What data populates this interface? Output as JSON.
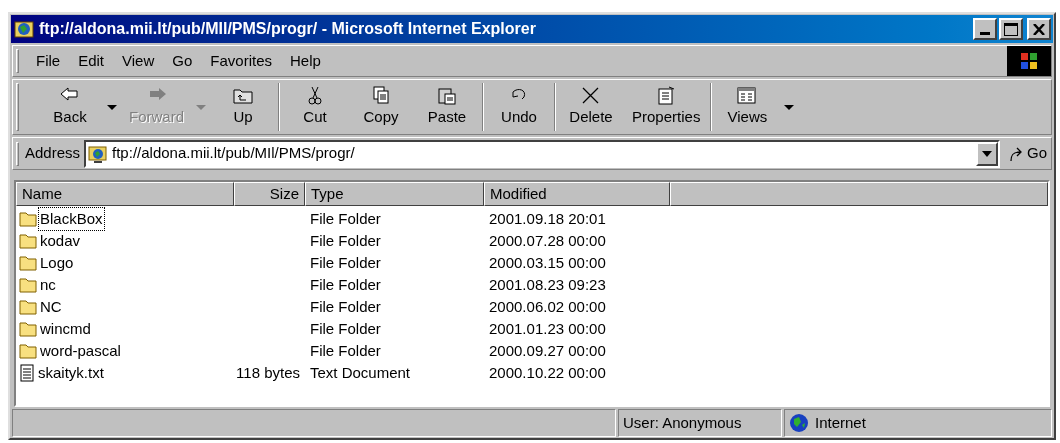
{
  "window": {
    "title": "ftp://aldona.mii.lt/pub/MIl/PMS/progr/ - Microsoft Internet Explorer"
  },
  "menu": [
    "File",
    "Edit",
    "View",
    "Go",
    "Favorites",
    "Help"
  ],
  "toolbar": [
    {
      "label": "Back",
      "disabled": false,
      "dropdown": true,
      "separator_before": false
    },
    {
      "label": "Forward",
      "disabled": true,
      "dropdown": true,
      "separator_before": false
    },
    {
      "label": "Up",
      "disabled": false,
      "dropdown": false,
      "separator_before": false
    },
    {
      "label": "Cut",
      "disabled": false,
      "dropdown": false,
      "separator_before": true
    },
    {
      "label": "Copy",
      "disabled": false,
      "dropdown": false,
      "separator_before": false
    },
    {
      "label": "Paste",
      "disabled": false,
      "dropdown": false,
      "separator_before": false
    },
    {
      "label": "Undo",
      "disabled": false,
      "dropdown": false,
      "separator_before": true
    },
    {
      "label": "Delete",
      "disabled": false,
      "dropdown": false,
      "separator_before": true
    },
    {
      "label": "Properties",
      "disabled": false,
      "dropdown": false,
      "separator_before": false
    },
    {
      "label": "Views",
      "disabled": false,
      "dropdown": true,
      "separator_before": true
    }
  ],
  "address": {
    "label": "Address",
    "value": "ftp://aldona.mii.lt/pub/MIl/PMS/progr/",
    "go": "Go"
  },
  "table": {
    "columns": [
      "Name",
      "Size",
      "Type",
      "Modified"
    ],
    "rows": [
      {
        "kind": "folder",
        "name": "BlackBox",
        "size": "",
        "type": "File Folder",
        "modified": "2001.09.18 20:01",
        "focused": true
      },
      {
        "kind": "folder",
        "name": "kodav",
        "size": "",
        "type": "File Folder",
        "modified": "2000.07.28 00:00",
        "focused": false
      },
      {
        "kind": "folder",
        "name": "Logo",
        "size": "",
        "type": "File Folder",
        "modified": "2000.03.15 00:00",
        "focused": false
      },
      {
        "kind": "folder",
        "name": "nc",
        "size": "",
        "type": "File Folder",
        "modified": "2001.08.23 09:23",
        "focused": false
      },
      {
        "kind": "folder",
        "name": "NC",
        "size": "",
        "type": "File Folder",
        "modified": "2000.06.02 00:00",
        "focused": false
      },
      {
        "kind": "folder",
        "name": "wincmd",
        "size": "",
        "type": "File Folder",
        "modified": "2001.01.23 00:00",
        "focused": false
      },
      {
        "kind": "folder",
        "name": "word-pascal",
        "size": "",
        "type": "File Folder",
        "modified": "2000.09.27 00:00",
        "focused": false
      },
      {
        "kind": "text",
        "name": "skaityk.txt",
        "size": "118 bytes",
        "type": "Text Document",
        "modified": "2000.10.22 00:00",
        "focused": false
      }
    ]
  },
  "status_bar": {
    "user": "User: Anonymous",
    "zone": "Internet"
  }
}
